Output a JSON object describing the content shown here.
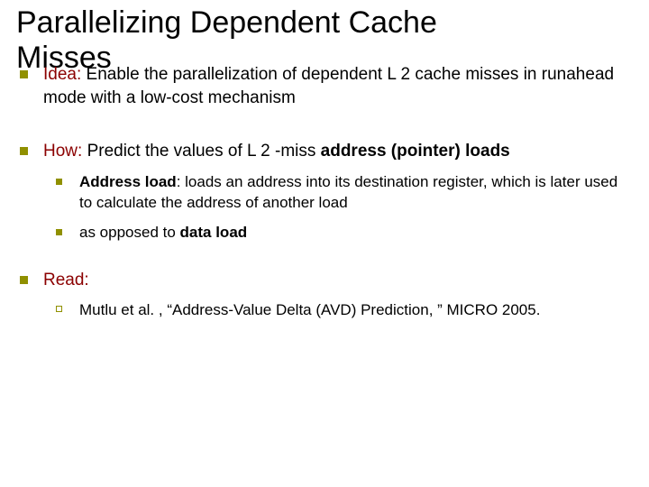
{
  "title_line1": "Parallelizing Dependent Cache",
  "title_line2": "Misses",
  "b1": {
    "lead": "Idea:",
    "rest": " Enable the parallelization of dependent L 2 cache misses in runahead mode with a low-cost mechanism"
  },
  "b2": {
    "lead": "How:",
    "mid": " Predict the values of L 2 -miss ",
    "bold": "address (pointer) loads"
  },
  "b2s1": {
    "bold": "Address load",
    "rest": ": loads an address into its destination register, which is later used to calculate the address of another load"
  },
  "b2s2": {
    "lead": "as opposed to ",
    "bold": "data load"
  },
  "b3": {
    "text": "Read:"
  },
  "b3s1": {
    "text": "Mutlu et al. , “Address-Value Delta (AVD) Prediction, ” MICRO 2005."
  }
}
